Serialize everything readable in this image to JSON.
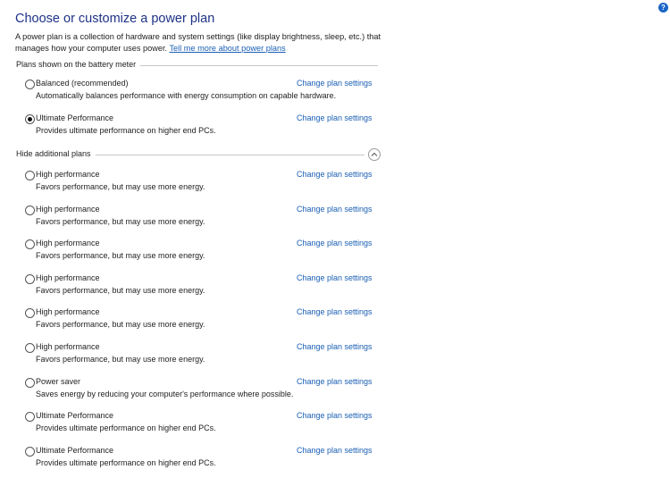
{
  "header": {
    "title": "Choose or customize a power plan",
    "description": "A power plan is a collection of hardware and system settings (like display brightness, sleep, etc.) that manages how your computer uses power. ",
    "learn_more_link": "Tell me more about power plans",
    "help_icon": "?"
  },
  "battery_meter_section": {
    "label": "Plans shown on the battery meter",
    "plans": [
      {
        "name": "Balanced (recommended)",
        "description": "Automatically balances performance with energy consumption on capable hardware.",
        "selected": false,
        "link": "Change plan settings"
      },
      {
        "name": "Ultimate Performance",
        "description": "Provides ultimate performance on higher end PCs.",
        "selected": true,
        "link": "Change plan settings"
      }
    ]
  },
  "additional_section": {
    "label": "Hide additional plans",
    "collapse_icon": "chevron-up",
    "plans": [
      {
        "name": "High performance",
        "description": "Favors performance, but may use more energy.",
        "selected": false,
        "link": "Change plan settings"
      },
      {
        "name": "High performance",
        "description": "Favors performance, but may use more energy.",
        "selected": false,
        "link": "Change plan settings"
      },
      {
        "name": "High performance",
        "description": "Favors performance, but may use more energy.",
        "selected": false,
        "link": "Change plan settings"
      },
      {
        "name": "High performance",
        "description": "Favors performance, but may use more energy.",
        "selected": false,
        "link": "Change plan settings"
      },
      {
        "name": "High performance",
        "description": "Favors performance, but may use more energy.",
        "selected": false,
        "link": "Change plan settings"
      },
      {
        "name": "High performance",
        "description": "Favors performance, but may use more energy.",
        "selected": false,
        "link": "Change plan settings"
      },
      {
        "name": "Power saver",
        "description": "Saves energy by reducing your computer's performance where possible.",
        "selected": false,
        "link": "Change plan settings"
      },
      {
        "name": "Ultimate Performance",
        "description": "Provides ultimate performance on higher end PCs.",
        "selected": false,
        "link": "Change plan settings"
      },
      {
        "name": "Ultimate Performance",
        "description": "Provides ultimate performance on higher end PCs.",
        "selected": false,
        "link": "Change plan settings"
      }
    ]
  },
  "colors": {
    "title": "#1e3287",
    "link": "#1a5fb4",
    "help_badge": "#1a66c6"
  }
}
